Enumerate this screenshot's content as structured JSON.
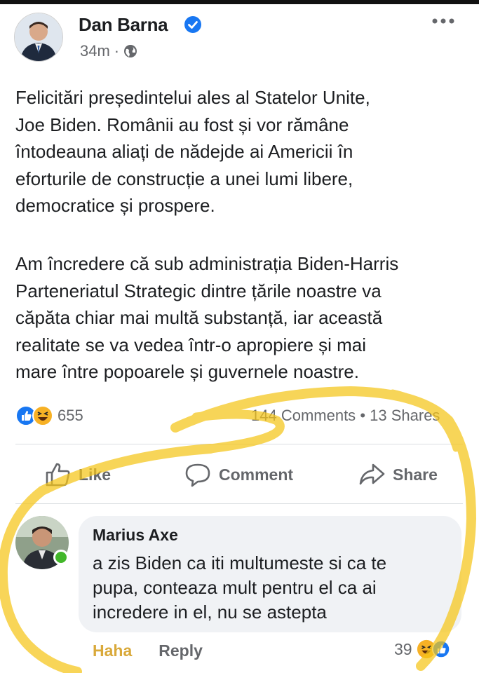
{
  "post": {
    "author": "Dan Barna",
    "time": "34m",
    "separator": "·",
    "paragraph1": [
      "Felicitări președintelui ales al Statelor Unite,",
      "Joe Biden. Românii au fost și vor rămâne",
      "întodeauna aliați de nădejde ai Americii în",
      "eforturile de construcție a unei lumi libere,",
      "democratice și prospere."
    ],
    "paragraph2": [
      "Am încredere că sub administrația Biden-Harris",
      "Parteneriatul Strategic dintre țările noastre va",
      "căpăta chiar mai multă substanță, iar această",
      "realitate se va vedea într-o apropiere și mai",
      "mare între popoarele și guvernele noastre."
    ],
    "reaction_count": "655",
    "comments": "144 Comments",
    "shares": "13 Shares",
    "dot": "•"
  },
  "actions": {
    "like": "Like",
    "comment": "Comment",
    "share": "Share"
  },
  "comment": {
    "author": "Marius Axe",
    "text": [
      "a zis Biden ca iti multumeste si ca te",
      "pupa, conteaza mult pentru el ca ai",
      "incredere in el, nu se astepta"
    ],
    "haha_label": "Haha",
    "reply_label": "Reply",
    "reaction_count": "39"
  },
  "colors": {
    "facebook_blue": "#1877f2",
    "muted_text": "#65676b",
    "haha_yellow": "#f7b125",
    "highlighter": "#f5c518"
  },
  "icons": [
    "verified-icon",
    "globe-icon",
    "more-icon",
    "like-reaction-icon",
    "haha-reaction-icon",
    "thumbs-up-icon",
    "comment-icon",
    "share-icon"
  ]
}
